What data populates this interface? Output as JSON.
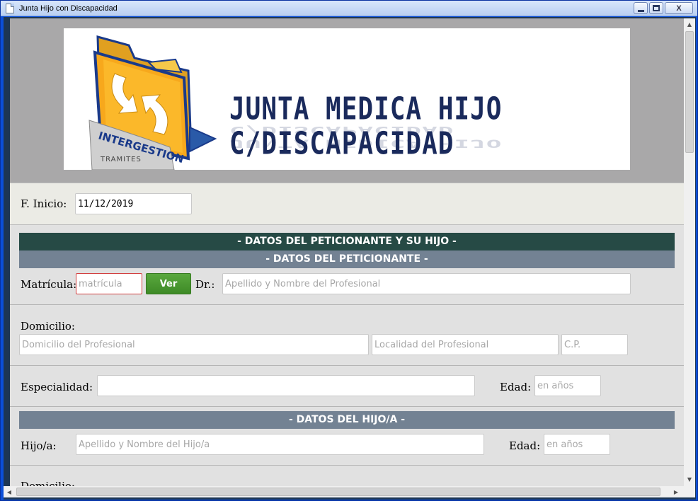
{
  "window": {
    "title": "Junta Hijo con Discapacidad",
    "minimize_label": "_",
    "close_label": "X"
  },
  "banner": {
    "title": "JUNTA MEDICA HIJO C/DISCAPACIDAD",
    "logo_text_main": "INTERGESTION",
    "logo_text_sub": "TRAMITES"
  },
  "fecha": {
    "label": "F. Inicio:",
    "value": "11/12/2019"
  },
  "section_main": {
    "title": "- DATOS DEL PETICIONANTE Y SU HIJO -"
  },
  "peticionante": {
    "title": "- DATOS DEL PETICIONANTE -",
    "matricula_label": "Matrícula:",
    "matricula_placeholder": "matrícula",
    "ver_button": "Ver",
    "dr_label": "Dr.:",
    "dr_placeholder": "Apellido y Nombre del Profesional",
    "domicilio_label": "Domicilio:",
    "domicilio_placeholder": "Domicilio del Profesional",
    "localidad_placeholder": "Localidad del Profesional",
    "cp_placeholder": "C.P.",
    "especialidad_label": "Especialidad:",
    "especialidad_value": "",
    "edad_label": "Edad:",
    "edad_placeholder": "en años"
  },
  "hijo": {
    "title": "- DATOS DEL HIJO/A -",
    "hijo_label": "Hijo/a:",
    "hijo_placeholder": "Apellido y Nombre del Hijo/a",
    "edad_label": "Edad:",
    "edad_placeholder": "en años",
    "domicilio_label": "Domicilio:"
  },
  "colors": {
    "header_dark": "#264a45",
    "header_grey": "#738293",
    "button_green": "#4a9a32",
    "invalid_border": "#d23f3f"
  }
}
